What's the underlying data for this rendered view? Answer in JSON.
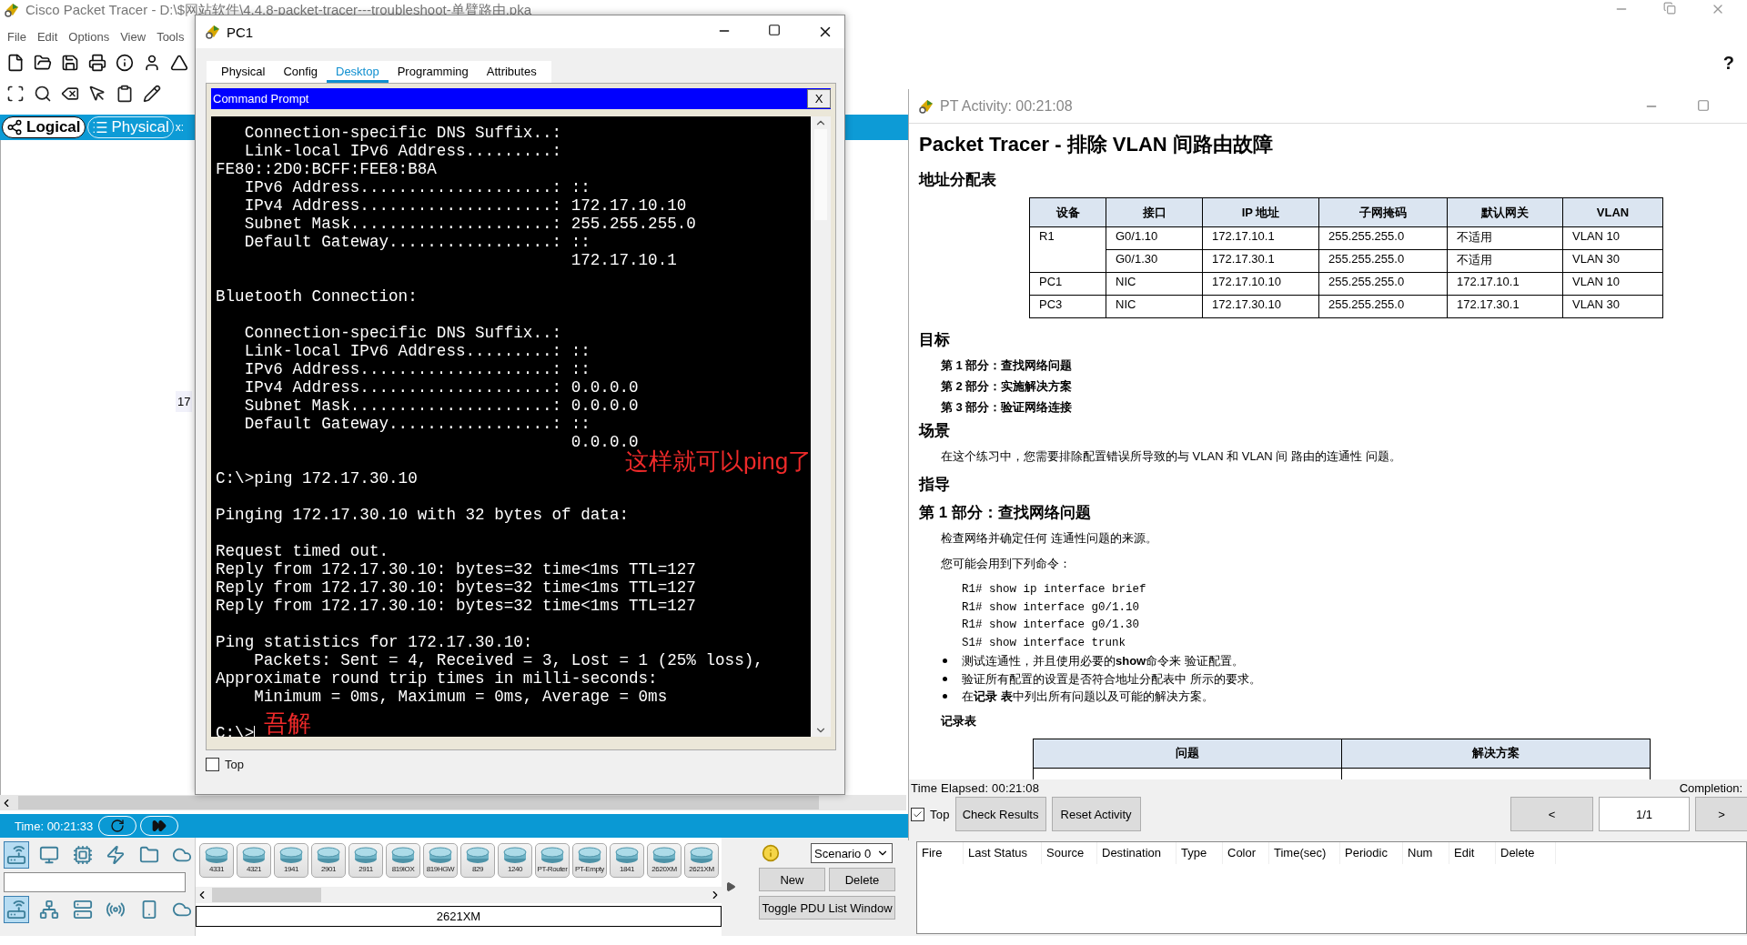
{
  "app": {
    "title": "Cisco Packet Tracer - D:\\$网站软件\\4.4.8-packet-tracer---troubleshoot-单臂路由.pka",
    "menu": [
      "File",
      "Edit",
      "Options",
      "View",
      "Tools"
    ],
    "help": "?",
    "view_tabs": [
      {
        "label": "Logical",
        "selected": true
      },
      {
        "label": "Physical",
        "selected": false
      }
    ],
    "coords": "x:",
    "canvas_label": "17",
    "time": "Time: 00:21:33",
    "category_rows": [
      [
        {
          "kind": "network",
          "selected": true
        },
        {
          "kind": "computer",
          "selected": false
        },
        {
          "kind": "board",
          "selected": false
        },
        {
          "kind": "lightning",
          "selected": false
        },
        {
          "kind": "folder",
          "selected": false
        },
        {
          "kind": "cloud",
          "selected": false
        }
      ],
      [
        {
          "kind": "router",
          "selected": true
        },
        {
          "kind": "switch",
          "selected": false
        },
        {
          "kind": "server",
          "selected": false
        },
        {
          "kind": "wireless",
          "selected": false
        },
        {
          "kind": "phone",
          "selected": false
        },
        {
          "kind": "cloud",
          "selected": false
        }
      ]
    ],
    "device_models": [
      "4331",
      "4321",
      "1941",
      "2901",
      "2911",
      "819IOX",
      "819HGW",
      "829",
      "1240",
      "PT-Router",
      "PT-Empty",
      "1841",
      "2620XM",
      "2621XM"
    ],
    "selected_model": "2621XM",
    "scenario": "Scenario 0",
    "scenario_buttons": [
      "New",
      "Delete"
    ],
    "toggle_button": "Toggle PDU List Window",
    "pdu_columns": [
      "Fire",
      "Last Status",
      "Source",
      "Destination",
      "Type",
      "Color",
      "Time(sec)",
      "Periodic",
      "Num",
      "Edit",
      "Delete"
    ]
  },
  "pc1": {
    "title": "PC1",
    "tabs": [
      {
        "label": "Physical",
        "selected": false
      },
      {
        "label": "Config",
        "selected": false
      },
      {
        "label": "Desktop",
        "selected": true
      },
      {
        "label": "Programming",
        "selected": false
      },
      {
        "label": "Attributes",
        "selected": false
      }
    ],
    "prompt_title": "Command Prompt",
    "close": "X",
    "console": [
      [
        "   Connection-specific DNS Suffix..:",
        "   Link-local IPv6 Address.........:",
        "FE80::2D0:BCFF:FEE8:B8A",
        "   IPv6 Address....................: ::",
        "   IPv4 Address....................: 172.17.10.10",
        "   Subnet Mask.....................: 255.255.255.0",
        "   Default Gateway.................: ::",
        "                                     172.17.10.1"
      ],
      [
        "Bluetooth Connection:"
      ],
      [
        "   Connection-specific DNS Suffix..:",
        "   Link-local IPv6 Address.........: ::",
        "   IPv6 Address....................: ::",
        "   IPv4 Address....................: 0.0.0.0",
        "   Subnet Mask.....................: 0.0.0.0",
        "   Default Gateway.................: ::",
        "                                     0.0.0.0"
      ],
      [
        "C:\\>ping 172.17.30.10"
      ],
      [
        "Pinging 172.17.30.10 with 32 bytes of data:"
      ],
      [
        "Request timed out.",
        "Reply from 172.17.30.10: bytes=32 time<1ms TTL=127",
        "Reply from 172.17.30.10: bytes=32 time<1ms TTL=127",
        "Reply from 172.17.30.10: bytes=32 time<1ms TTL=127"
      ],
      [
        "Ping statistics for 172.17.30.10:",
        "    Packets: Sent = 4, Received = 3, Lost = 1 (25% loss),",
        "Approximate round trip times in milli-seconds:",
        "    Minimum = 0ms, Maximum = 0ms, Average = 0ms"
      ],
      [
        "C:\\>"
      ]
    ],
    "annotations": [
      "这样就可以ping了",
      "吾解"
    ],
    "top": {
      "label": "Top",
      "checked": false
    }
  },
  "activity": {
    "title": "PT Activity: 00:21:08",
    "heading": "Packet Tracer - 排除 VLAN 间路由故障",
    "address_table": {
      "title": "地址分配表",
      "columns": [
        "设备",
        "接口",
        "IP 地址",
        "子网掩码",
        "默认网关",
        "VLAN"
      ],
      "rows": [
        {
          "device": "R1",
          "entries": [
            [
              "G0/1.10",
              "172.17.10.1",
              "255.255.255.0",
              "不适用",
              "VLAN 10"
            ],
            [
              "G0/1.30",
              "172.17.30.1",
              "255.255.255.0",
              "不适用",
              "VLAN 30"
            ]
          ]
        },
        {
          "device": "PC1",
          "entries": [
            [
              "NIC",
              "172.17.10.10",
              "255.255.255.0",
              "172.17.10.1",
              "VLAN 10"
            ]
          ]
        },
        {
          "device": "PC3",
          "entries": [
            [
              "NIC",
              "172.17.30.10",
              "255.255.255.0",
              "172.17.30.1",
              "VLAN 30"
            ]
          ]
        }
      ]
    },
    "objectives": {
      "title": "目标",
      "items": [
        "第 1 部分：查找网络问题",
        "第 2 部分：实施解决方案",
        "第 3 部分：验证网络连接"
      ]
    },
    "scenario": {
      "title": "场景",
      "text": "在这个练习中，您需要排除配置错误所导致的与 VLAN 和 VLAN 间 路由的连通性 问题。"
    },
    "instructions": {
      "title": "指导",
      "part_title": "第 1 部分：查找网络问题",
      "intro": "检查网络并确定任何 连通性问题的来源。",
      "commands_intro": "您可能会用到下列命令：",
      "commands": [
        "R1# show ip interface brief",
        "R1# show interface g0/1.10",
        "R1# show interface g0/1.30",
        "S1# show interface trunk"
      ],
      "bullets": [
        "测试连通性，并且使用必要的**show**命令来 验证配置。",
        "验证所有配置的设置是否符合地址分配表中 所示的要求。",
        "在**记录 表**中列出所有问题以及可能的解决方案。"
      ],
      "record_title": "记录表",
      "record_columns": [
        "问题",
        "解决方案"
      ]
    },
    "footer": {
      "elapsed": "Time Elapsed: 00:21:08",
      "completion": "Completion:",
      "top": {
        "label": "Top",
        "checked": true
      },
      "buttons": [
        "Check Results",
        "Reset Activity"
      ],
      "prev": "<",
      "page": "1/1",
      "next": ">"
    }
  }
}
